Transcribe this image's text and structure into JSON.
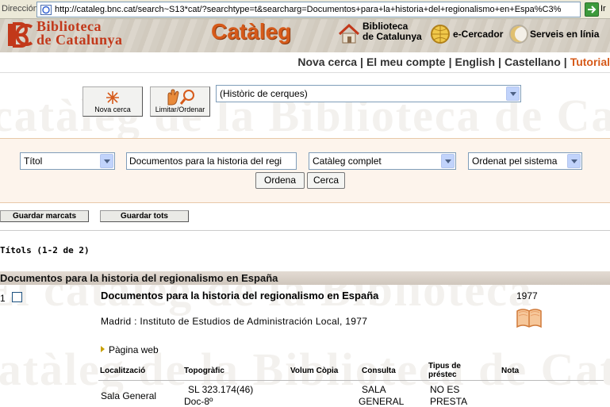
{
  "browser": {
    "address_label": "Dirección",
    "url": "http://cataleg.bnc.cat/search~S13*cat/?searchtype=t&searcharg=Documentos+para+la+historia+del+regionalismo+en+Espa%C3%",
    "go_label": "Ir"
  },
  "banner": {
    "logo_line1": "Biblioteca",
    "logo_line2": "de Catalunya",
    "title": "Catàleg",
    "links": [
      {
        "line1": "Biblioteca",
        "line2": "de Catalunya",
        "icon": "house-icon"
      },
      {
        "label": "e-Cercador",
        "icon": "globe-icon"
      },
      {
        "label": "Serveis en línia",
        "icon": "moon-icon"
      }
    ]
  },
  "topnav": {
    "items": [
      "Nova cerca",
      "El meu compte",
      "English",
      "Castellano",
      "Tutorial"
    ],
    "separator": "|",
    "accent_color": "#d65a1a"
  },
  "watermark": {
    "line1": "catàleg de la Biblioteca de Catalunya",
    "line2": "El catàleg de la Biblioteca",
    "line3": "catàleg de la Biblioteca de Catalunya"
  },
  "toolbar": {
    "new_search_label": "Nova cerca",
    "limit_sort_label": "Limitar/Ordenar",
    "history_value": "(Històric de cerques)"
  },
  "search": {
    "field_type": "Títol",
    "query": "Documentos para la historia del regi",
    "scope": "Catàleg complet",
    "sort": "Ordenat pel sistema",
    "sort_button": "Ordena",
    "search_button": "Cerca"
  },
  "actions": {
    "save_marked": "Guardar marcats",
    "save_all": "Guardar tots"
  },
  "results": {
    "count_label": "Títols (1-2 de 2)",
    "group_heading": "Documentos para la historia del regionalismo en España"
  },
  "record": {
    "number": "1",
    "title": "Documentos para la historia del regionalismo en España",
    "year": "1977",
    "publication": "Madrid : Instituto de Estudios de Administración Local, 1977",
    "web_label": "Pàgina web",
    "book_icon": "open-book-icon"
  },
  "holdings": {
    "headers": {
      "location": "Localització",
      "call_number": "Topogràfic",
      "volume": "Volum Còpia",
      "use": "Consulta",
      "loan_line1": "Tipus de",
      "loan_line2": "préstec",
      "note": "Nota"
    },
    "row": {
      "location": "Sala General",
      "call_line1": "SL 323.174(46)",
      "call_line2": "Doc-8º",
      "use_line1": "SALA",
      "use_line2": "GENERAL",
      "loan_line1": "NO ES",
      "loan_line2": "PRESTA"
    }
  }
}
